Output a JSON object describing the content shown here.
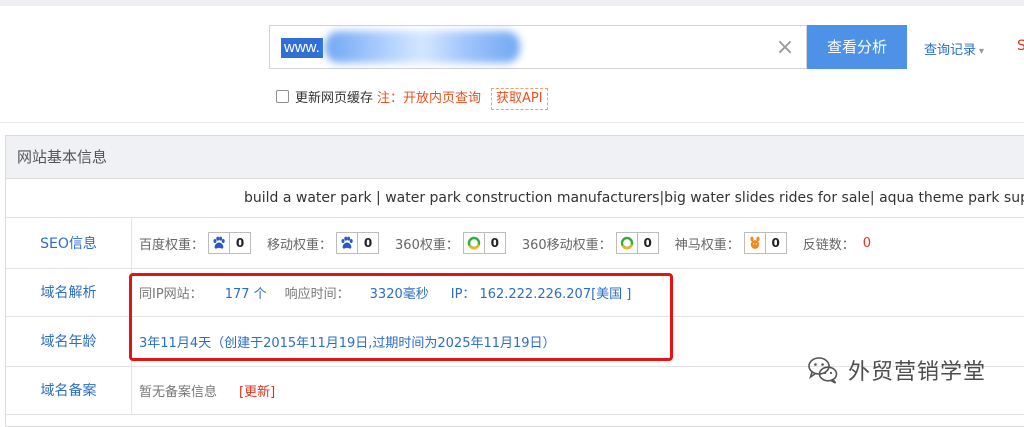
{
  "search": {
    "value": "www.",
    "clear_icon": "×",
    "button_label": "查看分析"
  },
  "history": {
    "label": "查询记录",
    "caret": "▾"
  },
  "cutoff_text": "S",
  "options": {
    "cache_label": "更新网页缓存",
    "note": "注：开放内页查询",
    "api_label": "获取API"
  },
  "panel": {
    "title": "网站基本信息",
    "site_title": "build a water park | water park construction manufacturers|big water slides rides for sale| aqua theme park supplier"
  },
  "rows": {
    "seo": {
      "label": "SEO信息",
      "metrics": [
        {
          "label": "百度权重：",
          "value": "0",
          "icon": "paw-icon"
        },
        {
          "label": "移动权重：",
          "value": "0",
          "icon": "paw-icon"
        },
        {
          "label": "360权重：",
          "value": "0",
          "icon": "360-icon"
        },
        {
          "label": "360移动权重：",
          "value": "0",
          "icon": "360-icon"
        },
        {
          "label": "神马权重：",
          "value": "0",
          "icon": "shenma-icon"
        }
      ],
      "backlinks_label": "反链数：",
      "backlinks_value": "0"
    },
    "dns": {
      "label": "域名解析",
      "same_ip_label": "同IP网站：",
      "same_ip_value": "177 个",
      "response_label": "响应时间：",
      "response_value": "3320毫秒",
      "ip_label": "IP：",
      "ip_value": "162.222.226.207[美国 ]"
    },
    "age": {
      "label": "域名年龄",
      "value": "3年11月4天（创建于2015年11月19日,过期时间为2025年11月19日）"
    },
    "icp": {
      "label": "域名备案",
      "value": "暂无备案信息",
      "update_label": "[更新]"
    }
  },
  "watermark": {
    "text": "外贸营销学堂"
  },
  "colors": {
    "accent_blue": "#4d92e6",
    "link_blue": "#2b6ec8",
    "alert_red": "#e0311d",
    "note_orange": "#e8501f",
    "highlight_box": "#e21414"
  }
}
